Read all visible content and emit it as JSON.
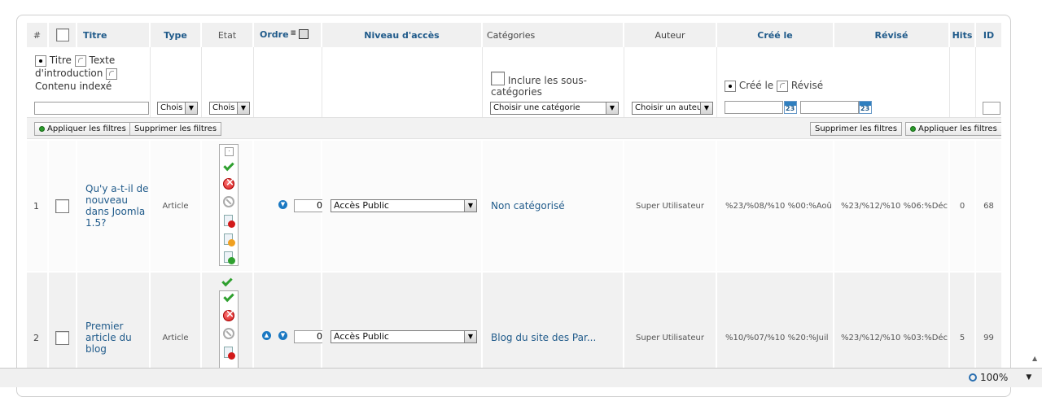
{
  "table": {
    "headers": {
      "num": "#",
      "titre": "Titre",
      "type": "Type",
      "etat": "Etat",
      "ordre": "Ordre",
      "niveau": "Niveau d'accès",
      "categories": "Catégories",
      "auteur": "Auteur",
      "cree": "Créé le",
      "revise": "Révisé",
      "hits": "Hits",
      "id": "ID"
    },
    "filters": {
      "radio_titre": "Titre",
      "radio_texte": "Texte",
      "radio_intro": "d'introduction",
      "radio_contenu": "Contenu indexé",
      "type_select": "Chois",
      "etat_select": "Chois",
      "inclure_label_1": "Inclure les sous-",
      "inclure_label_2": "catégories",
      "categorie_select": "Choisir une catégorie",
      "auteur_select": "Choisir un auteur",
      "radio_cree": "Créé le",
      "radio_revise": "Révisé",
      "calendar_day": "23"
    },
    "buttons": {
      "apply_left": "Appliquer les filtres",
      "clear_left": "Supprimer les filtres",
      "clear_right": "Supprimer les filtres",
      "apply_right": "Appliquer les filtres"
    },
    "rows": [
      {
        "num": "1",
        "title_lines": [
          "Qu'y a-t-il de",
          "nouveau",
          "dans Joomla",
          "1.5?"
        ],
        "type": "Article",
        "order": "0",
        "access": "Accès Public",
        "category": "Non catégorisé",
        "author": "Super Utilisateur",
        "created": "%23/%08/%10 %00:%Aoû",
        "revised": "%23/%12/%10 %06:%Déc",
        "hits": "0",
        "id": "68"
      },
      {
        "num": "2",
        "title_lines": [
          "Premier",
          "article du",
          "blog"
        ],
        "type": "Article",
        "order": "0",
        "access": "Accès Public",
        "category": "Blog du site des Par...",
        "author": "Super Utilisateur",
        "created": "%10/%07/%10 %20:%Juil",
        "revised": "%23/%12/%10 %03:%Déc",
        "hits": "5",
        "id": "99"
      }
    ]
  },
  "statusbar": {
    "zoom": "100%"
  }
}
